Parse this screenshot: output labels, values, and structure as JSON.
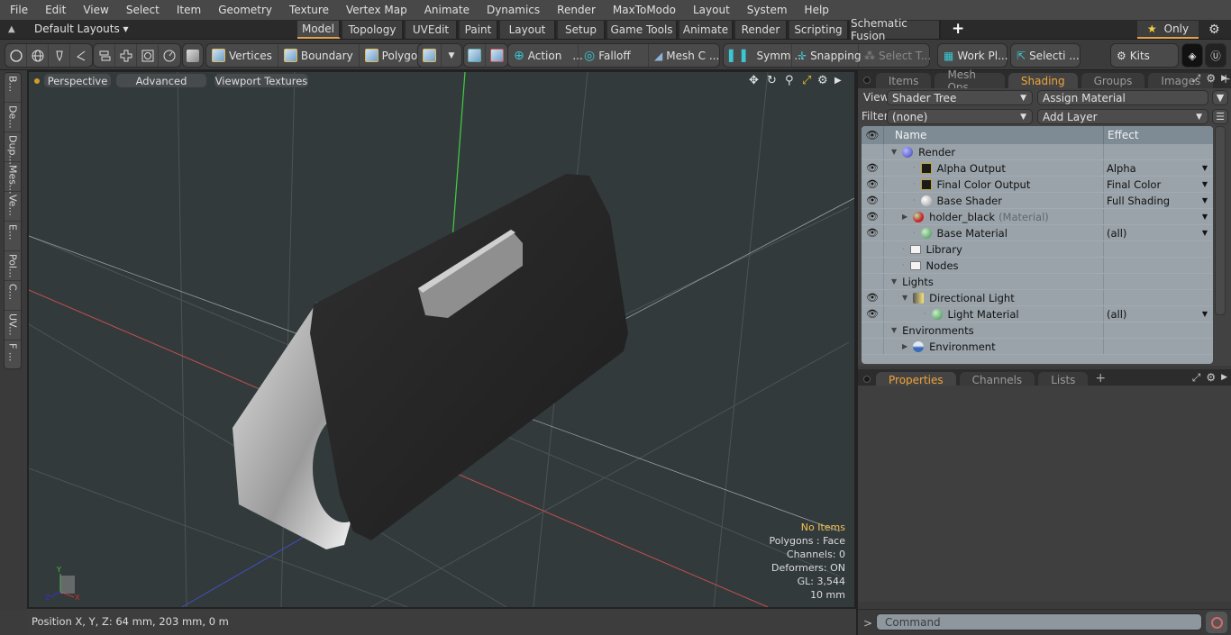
{
  "menu": [
    "File",
    "Edit",
    "View",
    "Select",
    "Item",
    "Geometry",
    "Texture",
    "Vertex Map",
    "Animate",
    "Dynamics",
    "Render",
    "MaxToModo",
    "Layout",
    "System",
    "Help"
  ],
  "layoutbar": {
    "layout_select": "Default Layouts ▾",
    "tabs": [
      "Model",
      "Topology",
      "UVEdit",
      "Paint",
      "Layout",
      "Setup",
      "Game Tools",
      "Animate",
      "Render",
      "Scripting",
      "Schematic Fusion"
    ],
    "active_tab": "Model",
    "add": "+",
    "only_star": "★",
    "only_label": "Only",
    "gear": "⚙"
  },
  "toolbar": {
    "select_modes": [
      "Vertices",
      "Boundary",
      "Polygons"
    ],
    "action": "Action",
    "action_more": "...",
    "falloff": "Falloff",
    "mesh_c": "Mesh C ...",
    "symm": "Symm ...",
    "snapping": "Snapping",
    "select_t": "Select T...",
    "work_pl": "Work Pl...",
    "selecti": "Selecti ...",
    "kits": "Kits"
  },
  "left_tabs": [
    "B...",
    "De...",
    "Dup...",
    "Mes...",
    "Ve...",
    "E...",
    "Pol...",
    "C...",
    "UV...",
    "F ..."
  ],
  "viewport": {
    "buttons": [
      "Perspective",
      "Advanced",
      "Viewport Textures"
    ],
    "info": {
      "no_items": "No Items",
      "polygons": "Polygons : Face",
      "channels": "Channels: 0",
      "deformers": "Deformers: ON",
      "gl": "GL: 3,544",
      "scale": "10 mm"
    },
    "axis_labels": {
      "x": "X",
      "y": "Y",
      "z": "Z"
    }
  },
  "status": {
    "position": "Position X, Y, Z:   64 mm, 203 mm, 0 m"
  },
  "right_panel": {
    "tabs": [
      "Items",
      "Mesh Ops",
      "Shading",
      "Groups",
      "Images"
    ],
    "active_tab": "Shading",
    "view_label": "View",
    "view_value": "Shader Tree",
    "assign_material": "Assign Material",
    "filter_label": "Filter",
    "filter_value": "(none)",
    "add_layer": "Add Layer",
    "tree_header": {
      "name": "Name",
      "effect": "Effect"
    },
    "tree_rows": [
      {
        "name": "Render",
        "effect": "",
        "eye": false,
        "indent": 0,
        "icon": "blue",
        "twisty": "▼"
      },
      {
        "name": "Alpha Output",
        "effect": "Alpha",
        "eye": true,
        "indent": 2,
        "icon": "out",
        "twisty": ""
      },
      {
        "name": "Final Color Output",
        "effect": "Final Color",
        "eye": true,
        "indent": 2,
        "icon": "out",
        "twisty": ""
      },
      {
        "name": "Base Shader",
        "effect": "Full Shading",
        "eye": true,
        "indent": 2,
        "icon": "white",
        "twisty": ""
      },
      {
        "name": "holder_black",
        "suffix": "(Material)",
        "effect": "",
        "eye": true,
        "indent": 1,
        "icon": "red",
        "twisty": "▶"
      },
      {
        "name": "Base Material",
        "effect": "(all)",
        "eye": true,
        "indent": 2,
        "icon": "green",
        "twisty": ""
      },
      {
        "name": "Library",
        "effect": "",
        "eye": false,
        "indent": 1,
        "icon": "folder",
        "twisty": ""
      },
      {
        "name": "Nodes",
        "effect": "",
        "eye": false,
        "indent": 1,
        "icon": "folder",
        "twisty": ""
      },
      {
        "name": "Lights",
        "effect": "",
        "eye": false,
        "indent": 0,
        "icon": "",
        "twisty": "▼"
      },
      {
        "name": "Directional Light",
        "effect": "",
        "eye": true,
        "indent": 1,
        "icon": "light",
        "twisty": "▼"
      },
      {
        "name": "Light Material",
        "effect": "(all)",
        "eye": true,
        "indent": 3,
        "icon": "green",
        "twisty": ""
      },
      {
        "name": "Environments",
        "effect": "",
        "eye": false,
        "indent": 0,
        "icon": "",
        "twisty": "▼"
      },
      {
        "name": "Environment",
        "effect": "",
        "eye": false,
        "indent": 1,
        "icon": "env",
        "twisty": "▶"
      }
    ],
    "bottom_tabs": [
      "Properties",
      "Channels",
      "Lists"
    ],
    "bottom_active": "Properties",
    "command_placeholder": "Command",
    "command_prompt": ">"
  }
}
